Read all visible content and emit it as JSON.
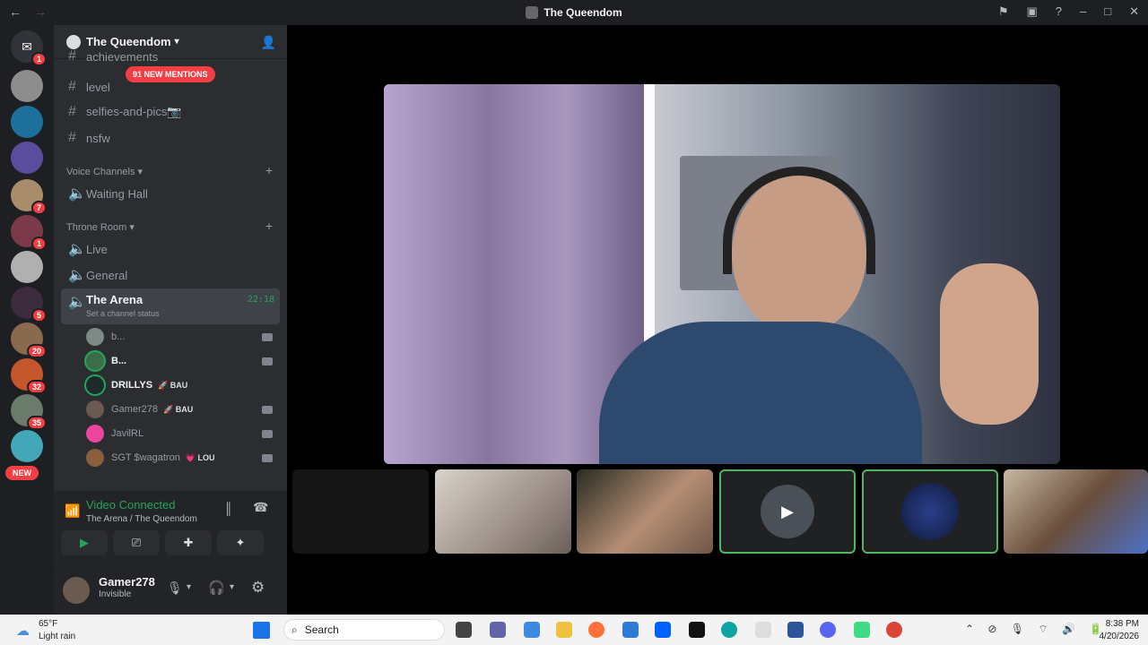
{
  "window": {
    "title": "The Queendom"
  },
  "servers": {
    "new_pill": "NEW",
    "badges": [
      "1",
      "1",
      "7",
      "1",
      "5",
      "20",
      "32",
      "35"
    ]
  },
  "guild": {
    "name": "The Queendom"
  },
  "mentions_pill": "91 NEW MENTIONS",
  "channels": {
    "text": [
      "achievements",
      "level",
      "selfies-and-pics📷",
      "nsfw"
    ],
    "voice_category": "Voice Channels",
    "waiting_hall": "Waiting Hall",
    "throne_category": "Throne Room",
    "live": "Live",
    "general": "General",
    "arena": {
      "name": "The Arena",
      "time": "22:18",
      "status": "Set a channel status"
    }
  },
  "voice_users": [
    {
      "name": "b...",
      "tag": ""
    },
    {
      "name": "B...",
      "tag": ""
    },
    {
      "name": "DRILLYS",
      "tag": "🚀 BAU"
    },
    {
      "name": "Gamer278",
      "tag": "🚀 BAU"
    },
    {
      "name": "JavilRL",
      "tag": ""
    },
    {
      "name": "SGT $wagatron",
      "tag": "💗 LOU"
    }
  ],
  "voice_panel": {
    "status": "Video Connected",
    "location": "The Arena / The Queendom"
  },
  "user_panel": {
    "name": "Gamer278",
    "status": "Invisible"
  },
  "taskbar": {
    "weather_temp": "65°F",
    "weather_desc": "Light rain",
    "search": "Search",
    "time": "8:38 PM",
    "date": "4/20/2026"
  },
  "colors": {
    "accent_green": "#23a55a",
    "badge_red": "#f23f43"
  }
}
